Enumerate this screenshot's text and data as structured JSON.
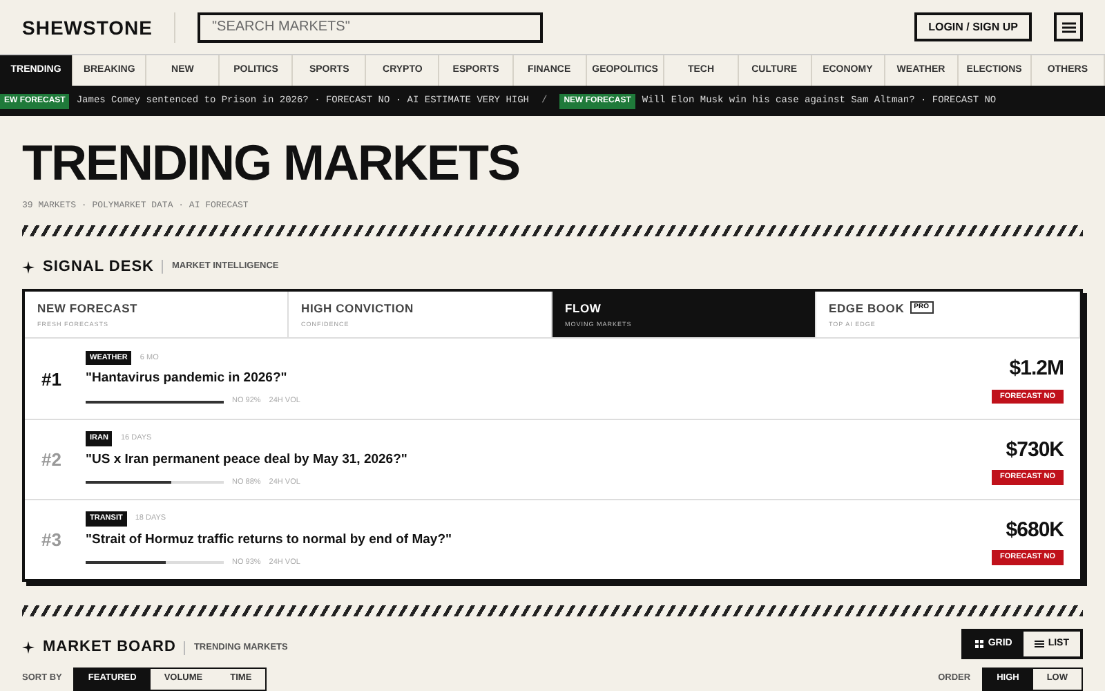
{
  "header": {
    "logo": "SHEWSTONE",
    "search": {
      "placeholder": "\"SEARCH MARKETS\""
    },
    "login": "LOGIN / SIGN UP"
  },
  "nav_tabs": [
    {
      "label": "TRENDING",
      "selected": true
    },
    {
      "label": "BREAKING",
      "selected": false
    },
    {
      "label": "NEW",
      "selected": false
    },
    {
      "label": "POLITICS",
      "selected": false
    },
    {
      "label": "SPORTS",
      "selected": false
    },
    {
      "label": "CRYPTO",
      "selected": false
    },
    {
      "label": "ESPORTS",
      "selected": false
    },
    {
      "label": "FINANCE",
      "selected": false
    },
    {
      "label": "GEOPOLITICS",
      "selected": false
    },
    {
      "label": "TECH",
      "selected": false
    },
    {
      "label": "CULTURE",
      "selected": false
    },
    {
      "label": "ECONOMY",
      "selected": false
    },
    {
      "label": "WEATHER",
      "selected": false
    },
    {
      "label": "ELECTIONS",
      "selected": false
    },
    {
      "label": "OTHERS",
      "selected": false
    }
  ],
  "ticker": [
    {
      "badge": "EW FORECAST",
      "text": "James Comey sentenced to Prison in 2026? · FORECAST NO · AI ESTIMATE VERY HIGH",
      "separator": "/"
    },
    {
      "badge": "NEW FORECAST",
      "text": "Will Elon Musk win his case against Sam Altman? · FORECAST NO"
    }
  ],
  "page": {
    "title": "TRENDING MARKETS",
    "subtitle": "39 MARKETS · POLYMARKET DATA · AI FORECAST"
  },
  "signal_desk": {
    "title": "SIGNAL DESK",
    "subtitle": "MARKET INTELLIGENCE",
    "tabs": [
      {
        "label": "NEW FORECAST",
        "sub": "FRESH FORECASTS",
        "selected": false
      },
      {
        "label": "HIGH CONVICTION",
        "sub": "CONFIDENCE",
        "selected": false
      },
      {
        "label": "FLOW",
        "sub": "MOVING MARKETS",
        "selected": true
      },
      {
        "label": "EDGE BOOK",
        "sub": "TOP AI EDGE",
        "badge": "PRO",
        "selected": false
      }
    ],
    "rows": [
      {
        "rank": "#1",
        "highlighted": true,
        "tag": "WEATHER",
        "time": "6 MO",
        "question": "\"Hantavirus pandemic in 2026?\"",
        "level": 1.0,
        "odds": "NO 92%",
        "vol_label": "24H VOL",
        "volume": "$1.2M",
        "forecast": "FORECAST NO"
      },
      {
        "rank": "#2",
        "highlighted": false,
        "tag": "IRAN",
        "time": "16 DAYS",
        "question": "\"US x Iran permanent peace deal by May 31, 2026?\"",
        "level": 0.62,
        "odds": "NO 88%",
        "vol_label": "24H VOL",
        "volume": "$730K",
        "forecast": "FORECAST NO"
      },
      {
        "rank": "#3",
        "highlighted": false,
        "tag": "TRANSIT",
        "time": "18 DAYS",
        "question": "\"Strait of Hormuz traffic returns to normal by end of May?\"",
        "level": 0.58,
        "odds": "NO 93%",
        "vol_label": "24H VOL",
        "volume": "$680K",
        "forecast": "FORECAST NO"
      }
    ]
  },
  "market_board": {
    "title": "MARKET BOARD",
    "subtitle": "TRENDING MARKETS",
    "views": [
      {
        "label": "GRID",
        "kind": "grid",
        "selected": true
      },
      {
        "label": "LIST",
        "kind": "list",
        "selected": false
      }
    ],
    "sort_label": "SORT BY",
    "sort": [
      {
        "label": "FEATURED",
        "selected": true
      },
      {
        "label": "VOLUME",
        "selected": false
      },
      {
        "label": "TIME",
        "selected": false
      }
    ],
    "order_label": "ORDER",
    "order": [
      {
        "label": "HIGH",
        "selected": true
      },
      {
        "label": "LOW",
        "selected": false
      }
    ]
  }
}
